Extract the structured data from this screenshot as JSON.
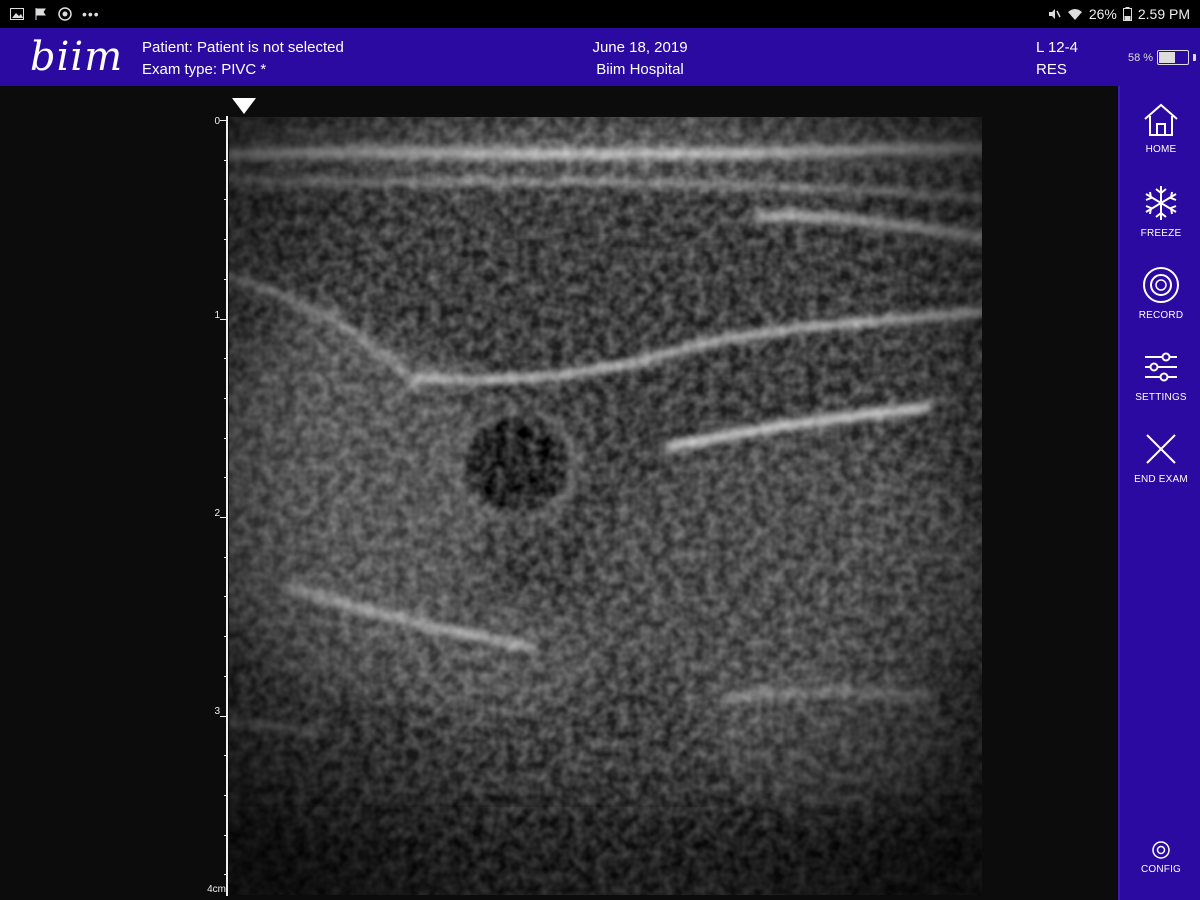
{
  "status_bar": {
    "battery_percent": "26%",
    "time": "2.59 PM",
    "left_icons": [
      "gallery-icon",
      "flag-icon",
      "app-icon",
      "more-icon"
    ],
    "right_icons": [
      "mute-icon",
      "wifi-icon",
      "battery-icon"
    ]
  },
  "header": {
    "logo": "biim",
    "patient_line": "Patient: Patient is not selected",
    "exam_line": "Exam type: PIVC *",
    "date": "June 18, 2019",
    "hospital": "Biim Hospital",
    "probe": "L 12-4",
    "mode": "RES",
    "battery_label": "58 %",
    "battery_level": 0.58,
    "colors": {
      "header_bg": "#2a0aa0",
      "sidebar_bg": "#2a0aa0"
    }
  },
  "sidebar": {
    "home_label": "HOME",
    "freeze_label": "FREEZE",
    "record_label": "RECORD",
    "settings_label": "SETTINGS",
    "end_exam_label": "END EXAM",
    "config_label": "CONFIG"
  },
  "depth_axis": {
    "labels": [
      "0",
      "1",
      "2",
      "3",
      "4cm"
    ],
    "unit": "cm"
  }
}
